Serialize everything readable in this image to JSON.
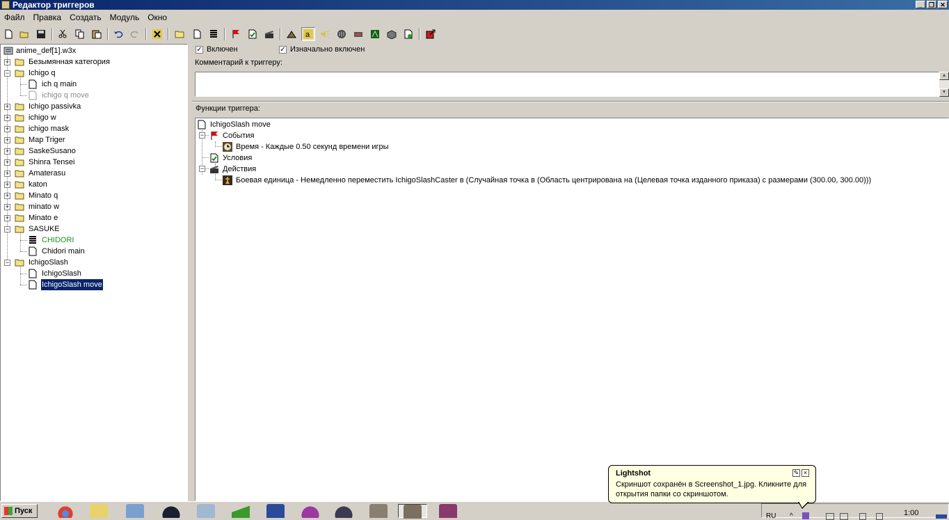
{
  "window": {
    "title": "Редактор триггеров",
    "btn_min": "_",
    "btn_max": "❐",
    "btn_close": "✕"
  },
  "menu": [
    "Файл",
    "Правка",
    "Создать",
    "Модуль",
    "Окно"
  ],
  "toolbar_icons": [
    "new-icon",
    "open-icon",
    "save-icon",
    "cut-icon",
    "copy-icon",
    "paste-icon",
    "undo-icon",
    "redo-icon",
    "delete-x-icon",
    "new-category-icon",
    "new-trigger-icon",
    "new-comment-icon",
    "event-flag-icon",
    "condition-icon",
    "action-icon",
    "terrain-icon",
    "unit-icon",
    "sound-icon",
    "ai-icon",
    "object-icon",
    "campaign-icon",
    "import-icon",
    "test-map-icon",
    "exit-icon"
  ],
  "left_tree": {
    "root": "anime_def[1].w3x",
    "items": [
      {
        "label": "Безымянная категория",
        "type": "folder",
        "expanded": false
      },
      {
        "label": "Ichigo q",
        "type": "folder",
        "expanded": true
      },
      {
        "label": "ich q main",
        "type": "trigger",
        "child": true
      },
      {
        "label": "ichigo q move",
        "type": "trigger",
        "child": true,
        "disabled": true
      },
      {
        "label": "Ichigo passivka",
        "type": "folder",
        "expanded": false
      },
      {
        "label": "ichigo w",
        "type": "folder",
        "expanded": false
      },
      {
        "label": "ichigo mask",
        "type": "folder",
        "expanded": false
      },
      {
        "label": "Map Triger",
        "type": "folder",
        "expanded": false
      },
      {
        "label": "SaskeSusano",
        "type": "folder",
        "expanded": false
      },
      {
        "label": "Shinra Tensei",
        "type": "folder",
        "expanded": false
      },
      {
        "label": "Amaterasu",
        "type": "folder",
        "expanded": false
      },
      {
        "label": "katon",
        "type": "folder",
        "expanded": false
      },
      {
        "label": "Minato q",
        "type": "folder",
        "expanded": false
      },
      {
        "label": "minato w",
        "type": "folder",
        "expanded": false
      },
      {
        "label": "Minato e",
        "type": "folder",
        "expanded": false
      },
      {
        "label": "SASUKE",
        "type": "folder",
        "expanded": true
      },
      {
        "label": "CHIDORI",
        "type": "variable",
        "child": true,
        "green": true
      },
      {
        "label": "Chidori main",
        "type": "trigger",
        "child": true
      },
      {
        "label": "IchigoSlash",
        "type": "folder",
        "expanded": true
      },
      {
        "label": "IchigoSlash",
        "type": "trigger",
        "child": true
      },
      {
        "label": "IchigoSlash move",
        "type": "trigger",
        "child": true,
        "selected": true
      }
    ]
  },
  "trigger": {
    "enabled_label": "Включен",
    "initially_enabled_label": "Изначально включен",
    "enabled_check": "✓",
    "initially_check": "✓",
    "comment_label": "Комментарий к триггеру:",
    "comment_value": "",
    "functions_label": "Функции триггера:",
    "name": "IchigoSlash move",
    "events_label": "События",
    "event_1": "Время - Каждые 0.50 секунд времени игры",
    "conditions_label": "Условия",
    "actions_label": "Действия",
    "action_1": "Боевая единица - Немедленно переместить IchigoSlashCaster в (Случайная точка в (Область центрирована на (Целевая точка изданного приказа) с размерами (300.00, 300.00)))"
  },
  "taskbar": {
    "start_label": "Пуск",
    "lang": "RU",
    "time": "1:00"
  },
  "balloon": {
    "title": "Lightshot",
    "text": "Скриншот сохранён в Screenshot_1.jpg. Кликните для открытия папки со скриншотом."
  },
  "colors": {
    "titlebar": "#0a246a",
    "selection": "#0a246a",
    "green_text": "#1f8a1f",
    "face": "#d4d0c8"
  }
}
